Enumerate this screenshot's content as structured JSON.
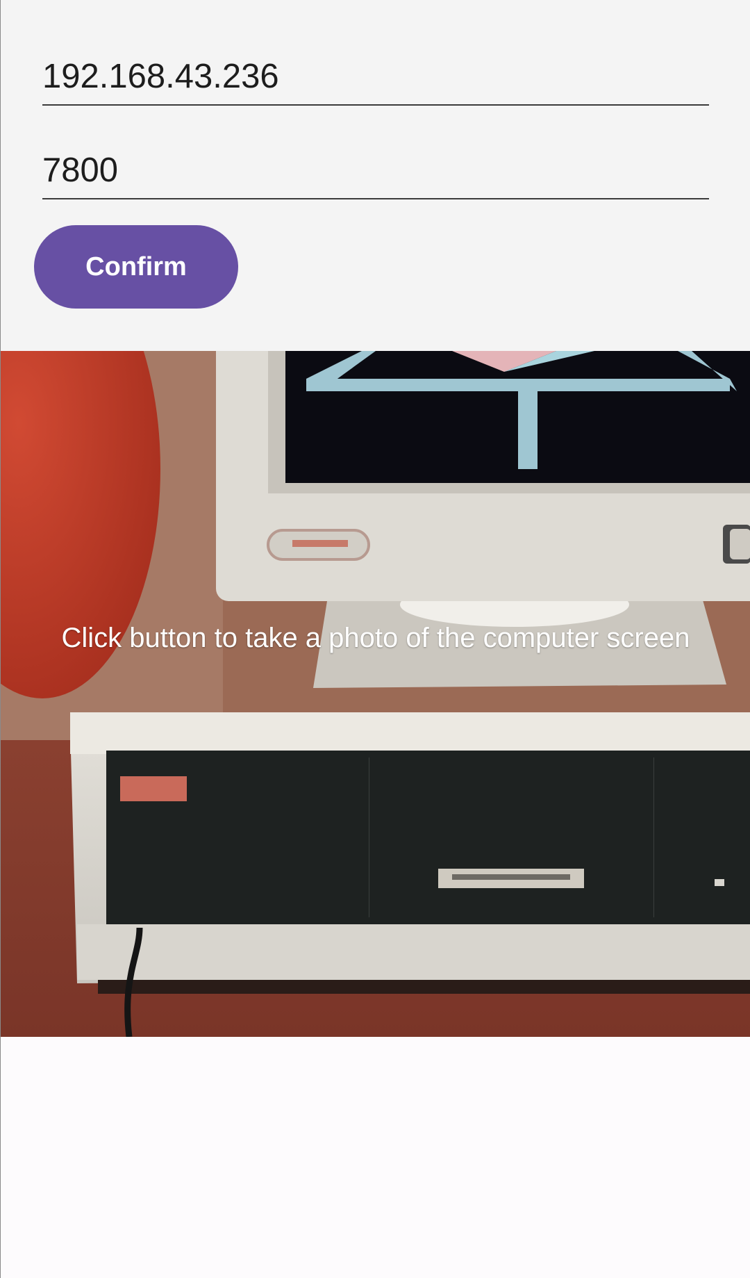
{
  "form": {
    "ip_value": "192.168.43.236",
    "port_value": "7800",
    "confirm_label": "Confirm"
  },
  "preview": {
    "caption": "Click button to take a photo of the computer screen"
  },
  "colors": {
    "button": "#6750a4",
    "form_background": "#f4f4f4",
    "page_background": "#fdfbfd"
  }
}
